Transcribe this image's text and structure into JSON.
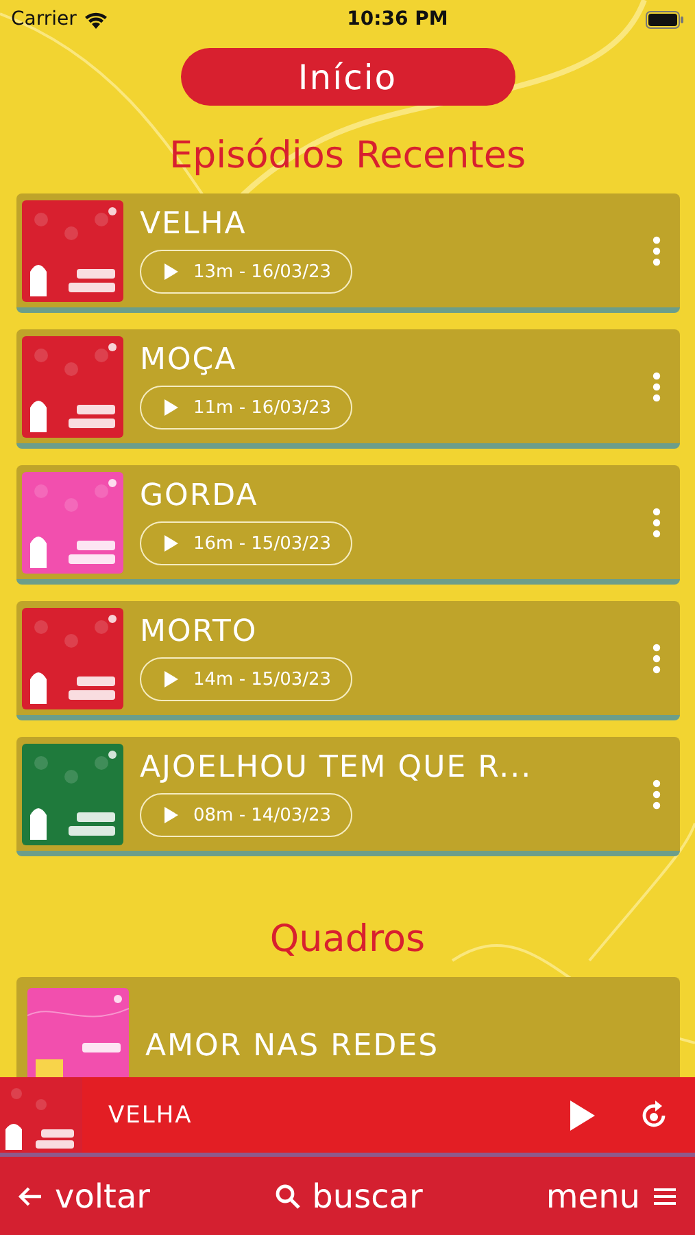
{
  "status_bar": {
    "carrier": "Carrier",
    "time": "10:36 PM"
  },
  "header": {
    "title": "Início"
  },
  "recent": {
    "heading": "Episódios Recentes",
    "episodes": [
      {
        "title": "VELHA",
        "meta": "13m - 16/03/23",
        "cover": {
          "color": "#d8202f"
        }
      },
      {
        "title": "MOÇA",
        "meta": "11m - 16/03/23",
        "cover": {
          "color": "#d8202f"
        }
      },
      {
        "title": "GORDA",
        "meta": "16m - 15/03/23",
        "cover": {
          "color": "#f24fae"
        }
      },
      {
        "title": "MORTO",
        "meta": "14m - 15/03/23",
        "cover": {
          "color": "#d8202f"
        }
      },
      {
        "title": "AJOELHOU TEM QUE R...",
        "meta": "08m - 14/03/23",
        "cover": {
          "color": "#1f7a3c"
        }
      }
    ]
  },
  "segments": {
    "heading": "Quadros",
    "items": [
      {
        "title": "AMOR NAS REDES",
        "cover": {
          "color": "#f24fae"
        }
      }
    ]
  },
  "player": {
    "title": "VELHA",
    "cover": {
      "color": "#d8202f"
    }
  },
  "nav": {
    "back": "voltar",
    "search": "buscar",
    "menu": "menu"
  }
}
